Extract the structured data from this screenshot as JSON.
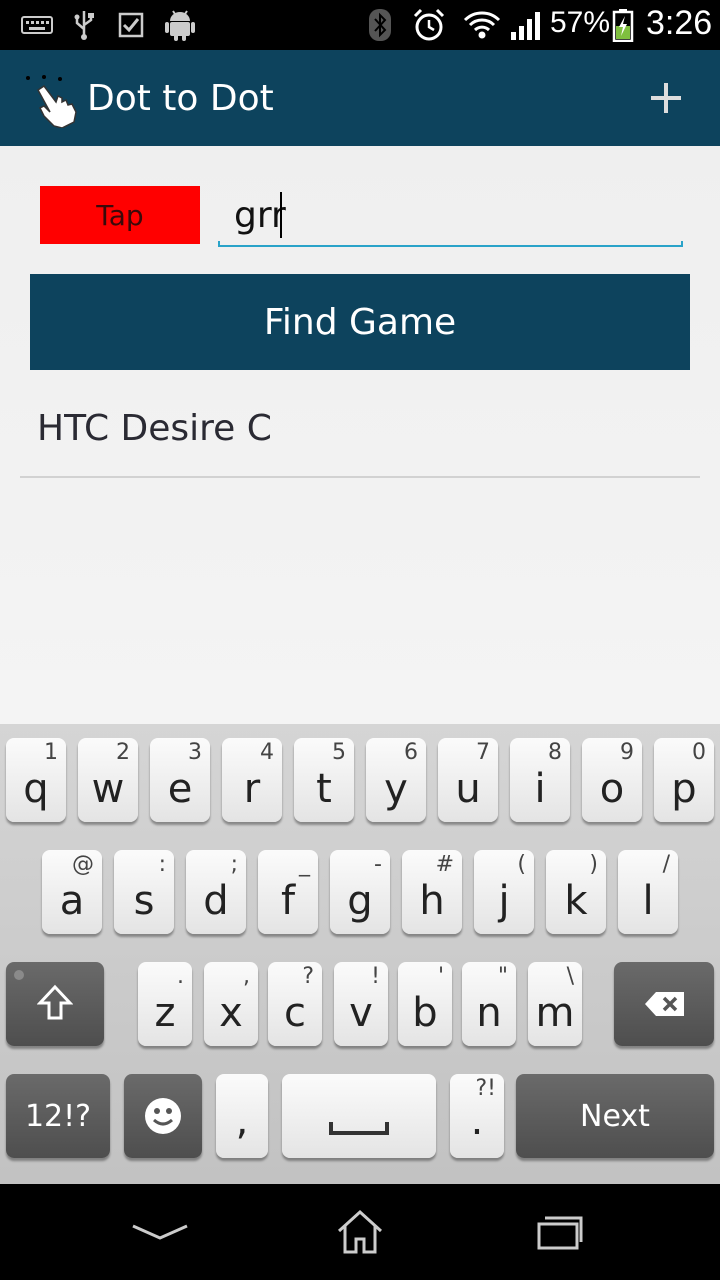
{
  "status_bar": {
    "battery": "57%",
    "time": "3:26",
    "icons": [
      "keyboard-icon",
      "usb-icon",
      "checkbox-icon",
      "android-icon",
      "bluetooth-icon",
      "alarm-icon",
      "wifi-icon",
      "signal-icon",
      "battery-charging-icon"
    ]
  },
  "action_bar": {
    "title": "Dot to Dot",
    "add_icon": "plus-icon",
    "app_icon": "tap-hand-icon",
    "color": "#0d435d"
  },
  "main": {
    "tap_label": "Tap",
    "tap_color": "#ff0000",
    "game_input_value": "grr",
    "find_game_label": "Find Game",
    "devices": [
      {
        "label": "HTC Desire C"
      }
    ]
  },
  "keyboard": {
    "row1": [
      {
        "key": "q",
        "hint": "1"
      },
      {
        "key": "w",
        "hint": "2"
      },
      {
        "key": "e",
        "hint": "3"
      },
      {
        "key": "r",
        "hint": "4"
      },
      {
        "key": "t",
        "hint": "5"
      },
      {
        "key": "y",
        "hint": "6"
      },
      {
        "key": "u",
        "hint": "7"
      },
      {
        "key": "i",
        "hint": "8"
      },
      {
        "key": "o",
        "hint": "9"
      },
      {
        "key": "p",
        "hint": "0"
      }
    ],
    "row2": [
      {
        "key": "a",
        "hint": "@"
      },
      {
        "key": "s",
        "hint": ":"
      },
      {
        "key": "d",
        "hint": ";"
      },
      {
        "key": "f",
        "hint": "_"
      },
      {
        "key": "g",
        "hint": "-"
      },
      {
        "key": "h",
        "hint": "#"
      },
      {
        "key": "j",
        "hint": "("
      },
      {
        "key": "k",
        "hint": ")"
      },
      {
        "key": "l",
        "hint": "/"
      }
    ],
    "row3": [
      {
        "key": "z",
        "hint": "."
      },
      {
        "key": "x",
        "hint": ","
      },
      {
        "key": "c",
        "hint": "?"
      },
      {
        "key": "v",
        "hint": "!"
      },
      {
        "key": "b",
        "hint": "'"
      },
      {
        "key": "n",
        "hint": "\""
      },
      {
        "key": "m",
        "hint": "\\"
      }
    ],
    "symbols_label": "12!?",
    "comma_key": ",",
    "period_key": ".",
    "period_hint": "?!",
    "next_label": "Next",
    "shift_icon": "shift-arrow-icon",
    "backspace_icon": "backspace-icon",
    "emoji_icon": "smiley-icon",
    "space_icon": "space-bar-icon"
  },
  "nav_bar": {
    "icons": [
      "hide-keyboard-chevron-icon",
      "home-icon",
      "recent-apps-icon"
    ]
  }
}
